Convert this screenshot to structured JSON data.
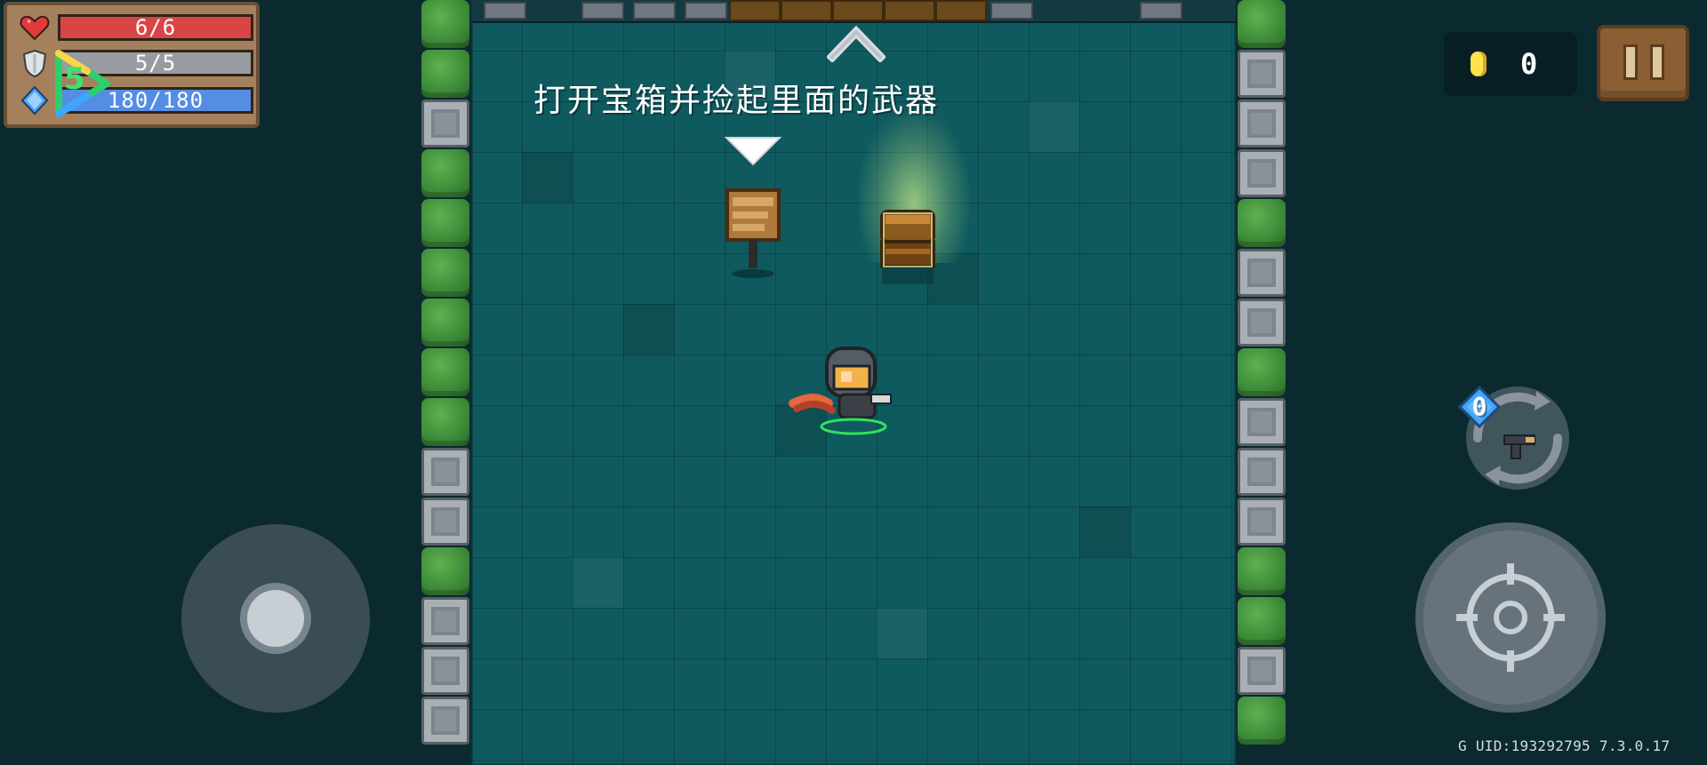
{
  "hud": {
    "hp": "6/6",
    "armor": "5/5",
    "energy": "180/180",
    "badge_level": "5",
    "hp_fraction": 1,
    "armor_fraction": 1,
    "energy_fraction": 1
  },
  "coins": {
    "value": "0"
  },
  "tutorial": {
    "instruction": "打开宝箱并捡起里面的武器"
  },
  "weapon": {
    "slot_count": "0"
  },
  "footer": {
    "uid_text": "G UID:193292795 7.3.0.17"
  },
  "colors": {
    "hp": "#d42c2c",
    "armor": "#8a8f95",
    "energy": "#3e7ee2",
    "floor": "#0f5a5f",
    "bush": "#3f8e3a",
    "stone": "#8a9299",
    "coin": "#ffe34a",
    "pause": "#8b5e34"
  },
  "icons": {
    "hp": "heart-icon",
    "armor": "shield-icon",
    "energy": "diamond-icon",
    "coin": "coin-icon",
    "pause": "pause-icon",
    "swap": "swap-icon",
    "gun": "pistol-icon",
    "aim": "crosshair-icon",
    "arrow_up": "chevron-up-icon",
    "arrow_down": "triangle-down-icon"
  }
}
